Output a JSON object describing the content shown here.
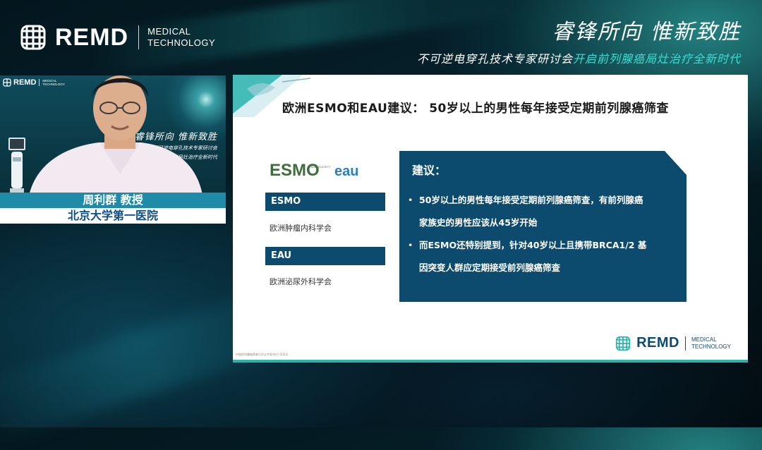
{
  "brand": {
    "name": "REMD",
    "sub_line1": "MEDICAL",
    "sub_line2": "TECHNOLOGY"
  },
  "slogan": {
    "main": "睿锋所向  惟新致胜",
    "line_white": "不可逆电穿孔技术专家研讨会",
    "line_cyan": "开启前列腺癌局灶治疗全新时代"
  },
  "speaker": {
    "name_title": "周利群 教授",
    "hospital": "北京大学第一医院",
    "mini_slogan_main": "睿锋所向  惟新致胜",
    "mini_slogan_sub1": "不可逆电穿孔技术专家研讨会",
    "mini_slogan_sub2": "开启前列腺癌局灶治疗全新时代"
  },
  "slide": {
    "heading": "欧洲ESMO和EAU建议： 50岁以上的男性每年接受定期前列腺癌筛查",
    "logo_esmo": "ESMO",
    "logo_esmo_sub": "ESMO SOCIETY",
    "logo_eau": "eau",
    "orgs": [
      {
        "tag": "ESMO",
        "desc": "欧洲肿瘤内科学会"
      },
      {
        "tag": "EAU",
        "desc": "欧洲泌尿外科学会"
      }
    ],
    "recommendation": {
      "title": "建议：",
      "bullets": [
        "50岁以上的男性每年接受定期前列腺癌筛查，有前列腺癌",
        "家族史的男性应该从45岁开始",
        "而ESMO还特别提到，针对40岁以上且携带BRCA1/2 基",
        "因突变人群应定期接受前列腺癌筛查"
      ]
    },
    "footnote": "中国前列腺癌筛查与早诊专家共识 (2022)",
    "brand_name": "REMD",
    "brand_sub1": "MEDICAL",
    "brand_sub2": "TECHNOLOGY"
  },
  "colors": {
    "slide_navy": "#0d4b6e",
    "accent_cyan": "#39e0d6",
    "caption_blue": "#1f8ba8",
    "hospital_text": "#0f4e8c"
  }
}
